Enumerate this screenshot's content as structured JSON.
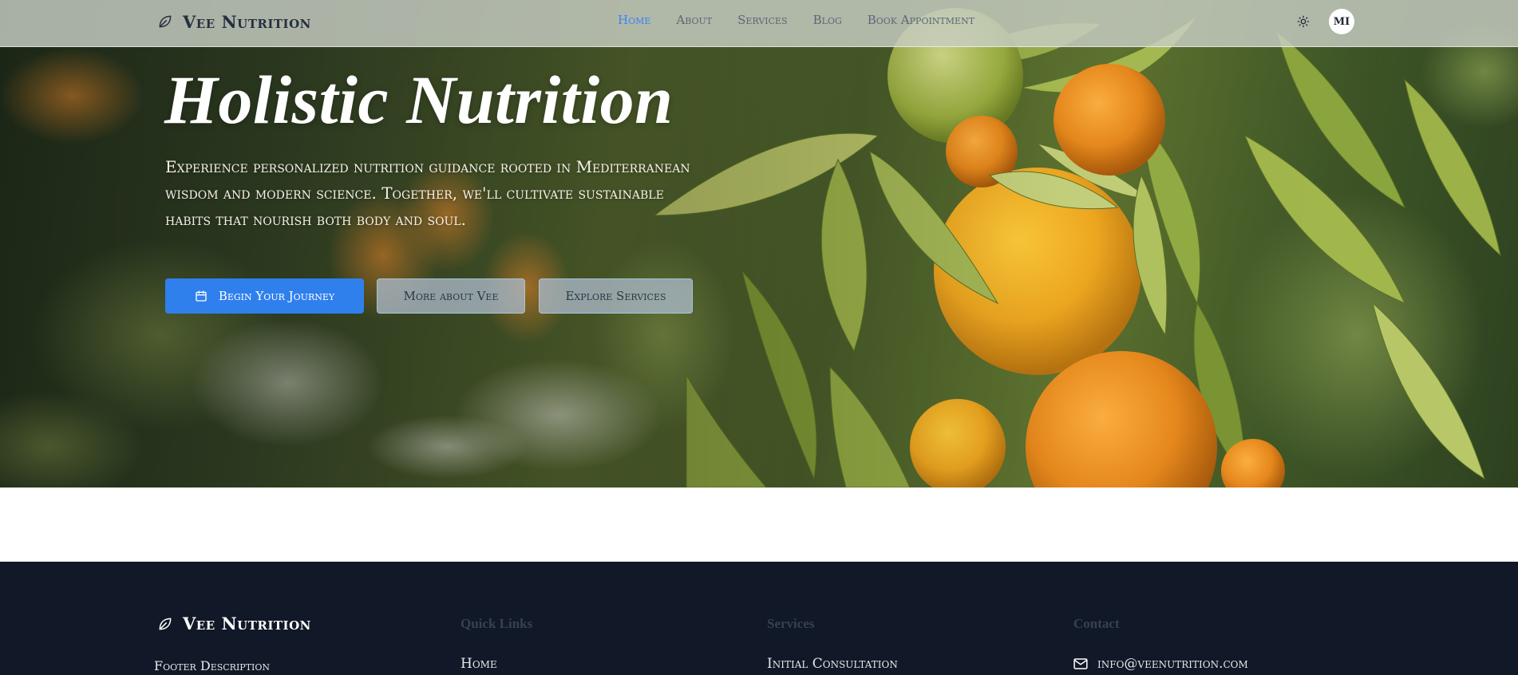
{
  "nav": {
    "brand": "Vee Nutrition",
    "links": [
      "Home",
      "About",
      "Services",
      "Blog",
      "Book Appointment"
    ],
    "active": "Home",
    "avatar_initials": "MI",
    "theme_icon": "sun-icon"
  },
  "hero": {
    "title": "Holistic Nutrition",
    "description": "Experience personalized nutrition guidance rooted in Mediterranean wisdom and modern science. Together, we'll cultivate sustainable habits that nourish both body and soul.",
    "buttons": {
      "primary": "Begin Your Journey",
      "about": "More about Vee",
      "services": "Explore Services"
    }
  },
  "footer": {
    "brand": "Vee Nutrition",
    "description": "Footer Description",
    "quick_links": {
      "heading": "Quick Links",
      "first": "Home"
    },
    "services": {
      "heading": "Services",
      "first": "Initial Consultation"
    },
    "contact": {
      "heading": "Contact",
      "email": "info@veenutrition.com"
    }
  },
  "colors": {
    "accent": "#2f80ed",
    "footer_bg": "#111827",
    "nav_active": "#3b82f6"
  }
}
